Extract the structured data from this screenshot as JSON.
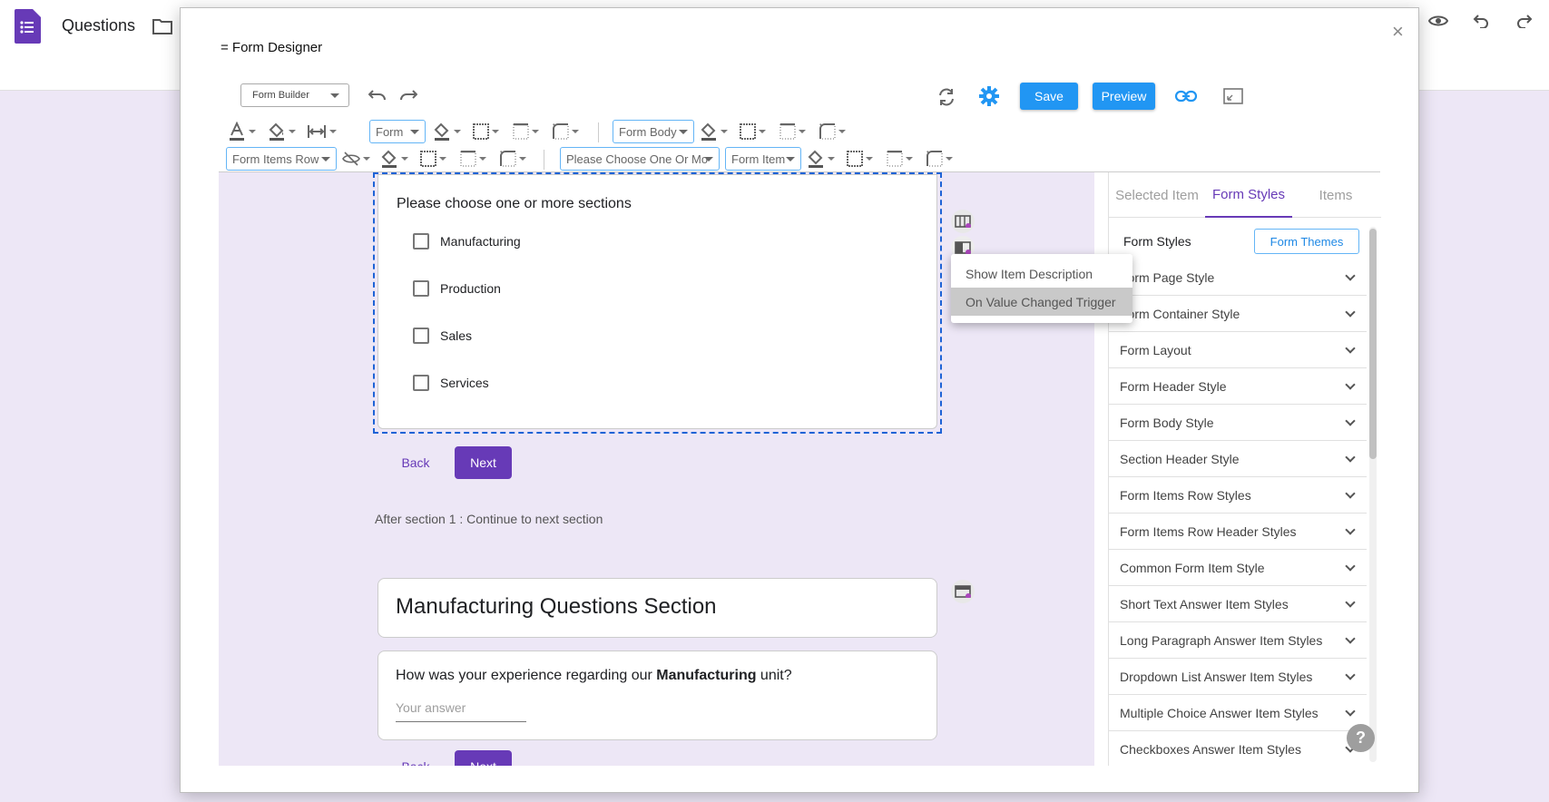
{
  "app": {
    "title": "Questions",
    "form_icon": "form-doc-icon",
    "folder_icon": "folder-icon",
    "top_right_icons": [
      "eye-icon",
      "undo-icon",
      "redo-icon"
    ],
    "brand_color": "#673ab7"
  },
  "dialog": {
    "title": "= Form Designer",
    "close_label": "×",
    "mode_select": "Form Builder",
    "save_label": "Save",
    "preview_label": "Preview"
  },
  "toolbar": {
    "row1": {
      "form_select": "Form",
      "body_select": "Form Body"
    },
    "row2": {
      "items_row_select": "Form Items Row",
      "question_select": "Please Choose One Or Mo",
      "item_select": "Form Item"
    }
  },
  "section1": {
    "question": "Please choose one or more sections",
    "options": [
      "Manufacturing",
      "Production",
      "Sales",
      "Services"
    ],
    "back_label": "Back",
    "next_label": "Next",
    "after_text": "After section 1 : Continue to next section"
  },
  "section2": {
    "title": "Manufacturing Questions Section",
    "question_prefix": "How was your experience regarding our ",
    "question_bold": "Manufacturing",
    "question_suffix": " unit?",
    "answer_placeholder": "Your answer",
    "back_label": "Back",
    "next_label": "Next"
  },
  "context_menu": {
    "items": [
      "Show Item Description",
      "On Value Changed Trigger"
    ],
    "highlighted": "On Value Changed Trigger"
  },
  "right_panel": {
    "tabs": [
      "Selected Item",
      "Form Styles",
      "Items"
    ],
    "active_tab": "Form Styles",
    "header": "Form Styles",
    "themes_button": "Form Themes",
    "accordion": [
      "Form Page Style",
      "Form Container Style",
      "Form Layout",
      "Form Header Style",
      "Form Body Style",
      "Section Header Style",
      "Form Items Row Styles",
      "Form Items Row Header Styles",
      "Common Form Item Style",
      "Short Text Answer Item Styles",
      "Long Paragraph Answer Item Styles",
      "Dropdown List Answer Item Styles",
      "Multiple Choice Answer Item Styles",
      "Checkboxes Answer Item Styles"
    ]
  },
  "help_label": "?"
}
